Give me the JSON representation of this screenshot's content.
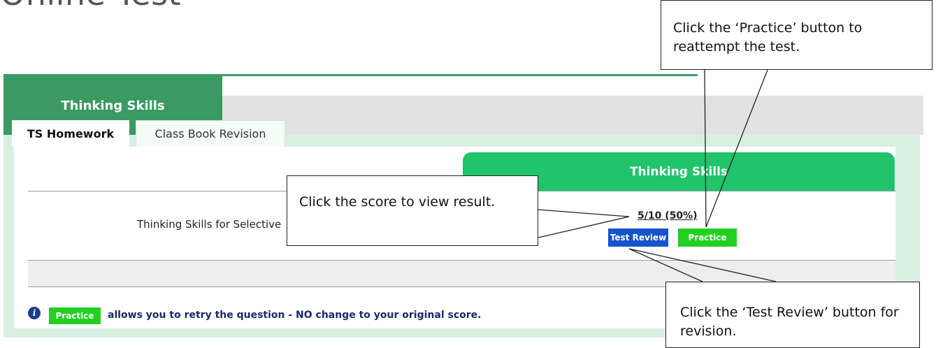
{
  "page": {
    "title": "Online Test"
  },
  "section_tab": {
    "label": "Thinking Skills"
  },
  "subtabs": [
    {
      "label": "TS Homework",
      "active": true
    },
    {
      "label": "Class Book Revision",
      "active": false
    }
  ],
  "panel": {
    "header": "Thinking Skills",
    "row_label": "Thinking Skills for Selective",
    "score": "5/10 (50%)",
    "test_review_label": "Test Review",
    "practice_label": "Practice"
  },
  "note": {
    "icon": "info-icon",
    "practice_label": "Practice",
    "text": "allows you to retry the question - NO change to your original score."
  },
  "callouts": {
    "practice": "Click the ‘Practice’ button to reattempt the test.",
    "score": "Click the score to view result.",
    "review": "Click the ‘Test Review’ button for revision."
  },
  "colors": {
    "section_green": "#3a9a61",
    "header_green": "#20c46a",
    "review_blue": "#1555cc",
    "practice_green": "#22d022",
    "panel_bg": "#d8f0e2"
  }
}
